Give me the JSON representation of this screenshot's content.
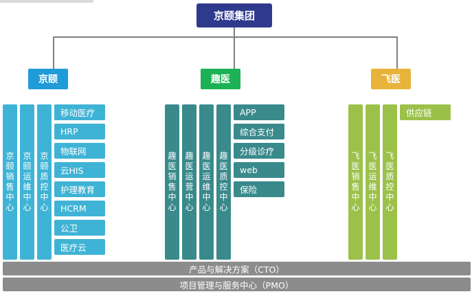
{
  "root": {
    "label": "京颐集团"
  },
  "groups": [
    {
      "label": "京颐",
      "color": "#1f9bd7",
      "col_color": "#3fb3d5",
      "item_color": "#3fb3d5",
      "columns": [
        "京颐销售中心",
        "京颐运维中心",
        "京颐质控中心"
      ],
      "items": [
        "移动医疗",
        "HRP",
        "物联网",
        "云HIS",
        "护理教育",
        "HCRM",
        "公卫",
        "医疗云"
      ]
    },
    {
      "label": "趣医",
      "color": "#1db155",
      "col_color": "#3a8a8c",
      "item_color": "#3a8a8c",
      "columns": [
        "趣医销售中心",
        "趣医运营中心",
        "趣医运维中心",
        "趣医质控中心"
      ],
      "items": [
        "APP",
        "综合支付",
        "分级诊疗",
        "web",
        "保险"
      ]
    },
    {
      "label": "飞医",
      "color": "#e8b33a",
      "col_color": "#9cc14a",
      "item_color": "#9cc14a",
      "columns": [
        "飞医销售中心",
        "飞医运维中心",
        "飞医质控中心"
      ],
      "items": [
        "供应链"
      ]
    }
  ],
  "bottom": {
    "cto": "产品与解决方案（CTO）",
    "pmo": "项目管理与服务中心（PMO）"
  }
}
